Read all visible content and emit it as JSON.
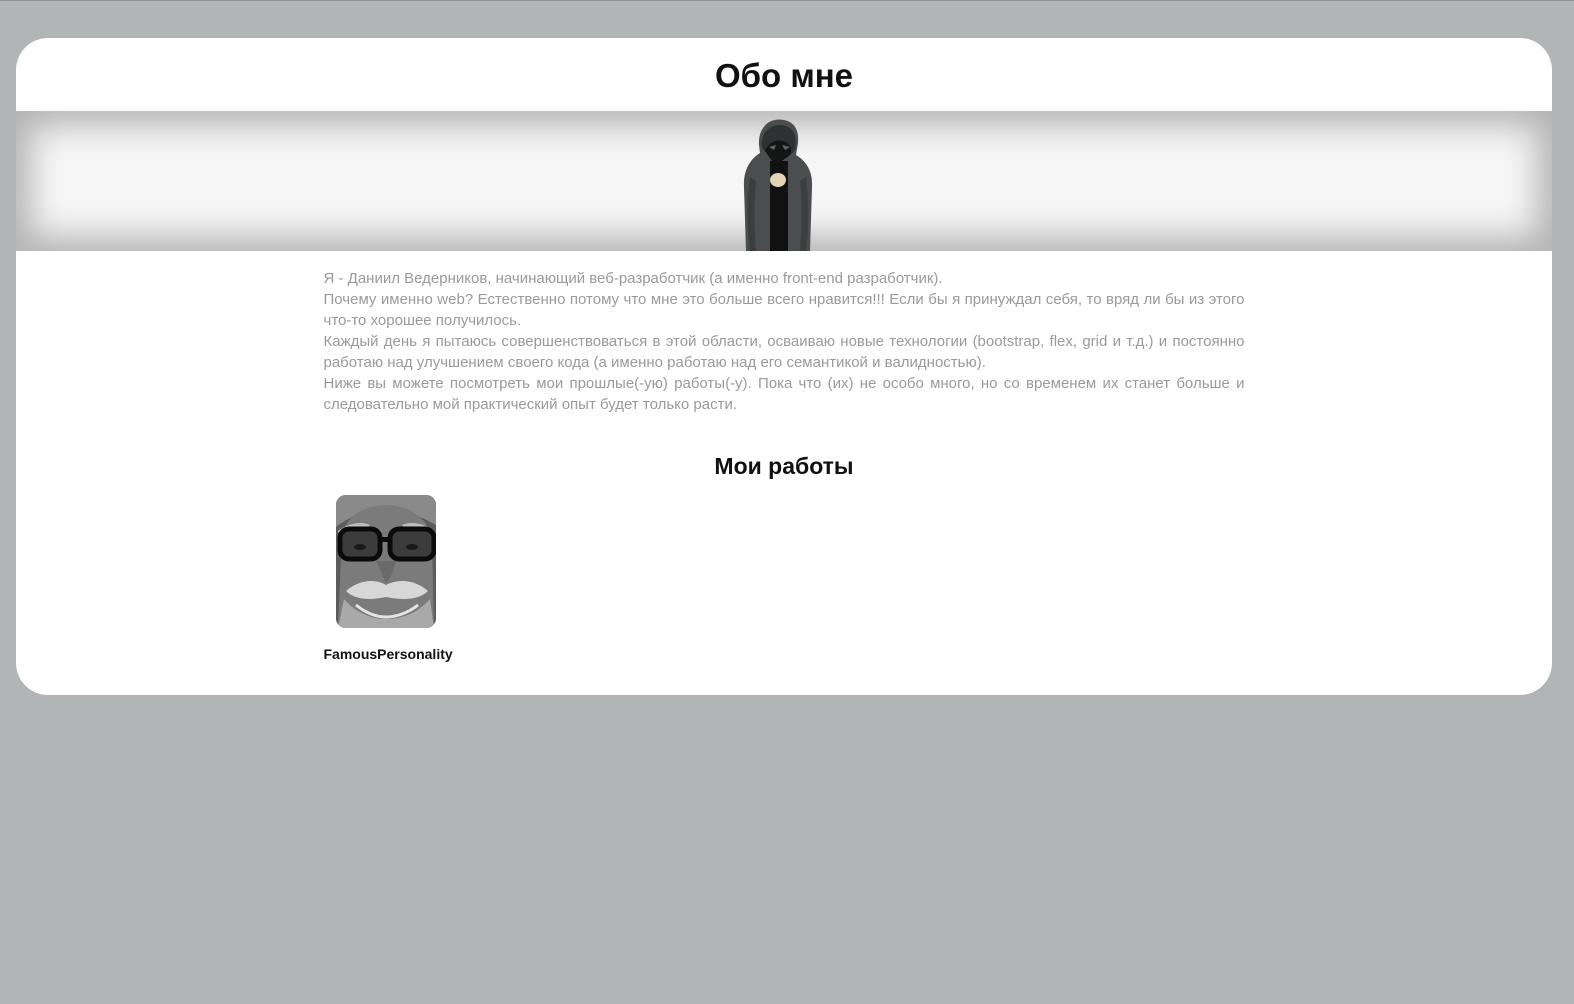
{
  "page": {
    "title": "Обо мне"
  },
  "about": {
    "paragraphs": [
      "Я - Даниил Ведерников, начинающий веб-разработчик (а именно front-end разработчик).",
      "Почему именно web? Естественно потому что мне это больше всего нравится!!! Если бы я принуждал себя, то вряд ли бы из этого что-то хорошее получилось.",
      "Каждый день я пытаюсь совершенствоваться в этой области, осваиваю новые технологии (bootstrap, flex, grid и т.д.) и постоянно работаю над улучшением своего кода (а именно работаю над его семантикой и валидностью).",
      "Ниже вы можете посмотреть мои прошлые(-ую) работы(-у). Пока что (их) не особо много, но со временем их станет больше и следовательно мой практический опыт будет только расти."
    ]
  },
  "works": {
    "title": "Мои работы",
    "items": [
      {
        "label": "FamousPersonality"
      }
    ]
  },
  "colors": {
    "page_background": "#b1b5b5",
    "card_background": "#ffffff",
    "body_text": "#9a9a9a",
    "heading_text": "#111111"
  }
}
